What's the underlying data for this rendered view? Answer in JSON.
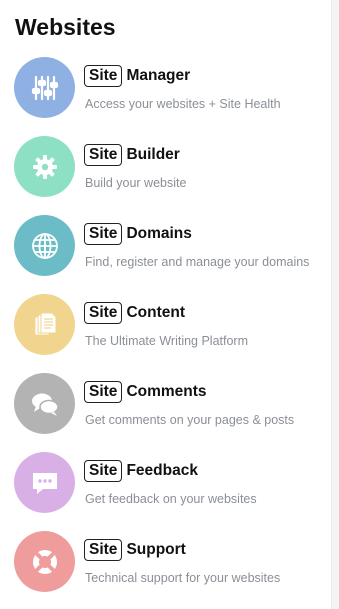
{
  "heading": "Websites",
  "colors": {
    "manager": "#8fb0e3",
    "builder": "#8ee0c4",
    "domains": "#6bbcc6",
    "content": "#f1d58e",
    "comments": "#b3b3b3",
    "feedback": "#d9b0e6",
    "support": "#ee9c9c"
  },
  "items": [
    {
      "badge": "Site",
      "name": "Manager",
      "desc": "Access your websites + Site Health",
      "icon": "sliders-icon"
    },
    {
      "badge": "Site",
      "name": "Builder",
      "desc": "Build your website",
      "icon": "gear-icon"
    },
    {
      "badge": "Site",
      "name": "Domains",
      "desc": "Find, register and manage your domains",
      "icon": "globe-icon"
    },
    {
      "badge": "Site",
      "name": "Content",
      "desc": "The Ultimate Writing Platform",
      "icon": "documents-icon"
    },
    {
      "badge": "Site",
      "name": "Comments",
      "desc": "Get comments on your pages & posts",
      "icon": "chat-bubbles-icon"
    },
    {
      "badge": "Site",
      "name": "Feedback",
      "desc": "Get feedback on your websites",
      "icon": "feedback-bubble-icon"
    },
    {
      "badge": "Site",
      "name": "Support",
      "desc": "Technical support for your websites",
      "icon": "lifebuoy-icon"
    }
  ]
}
